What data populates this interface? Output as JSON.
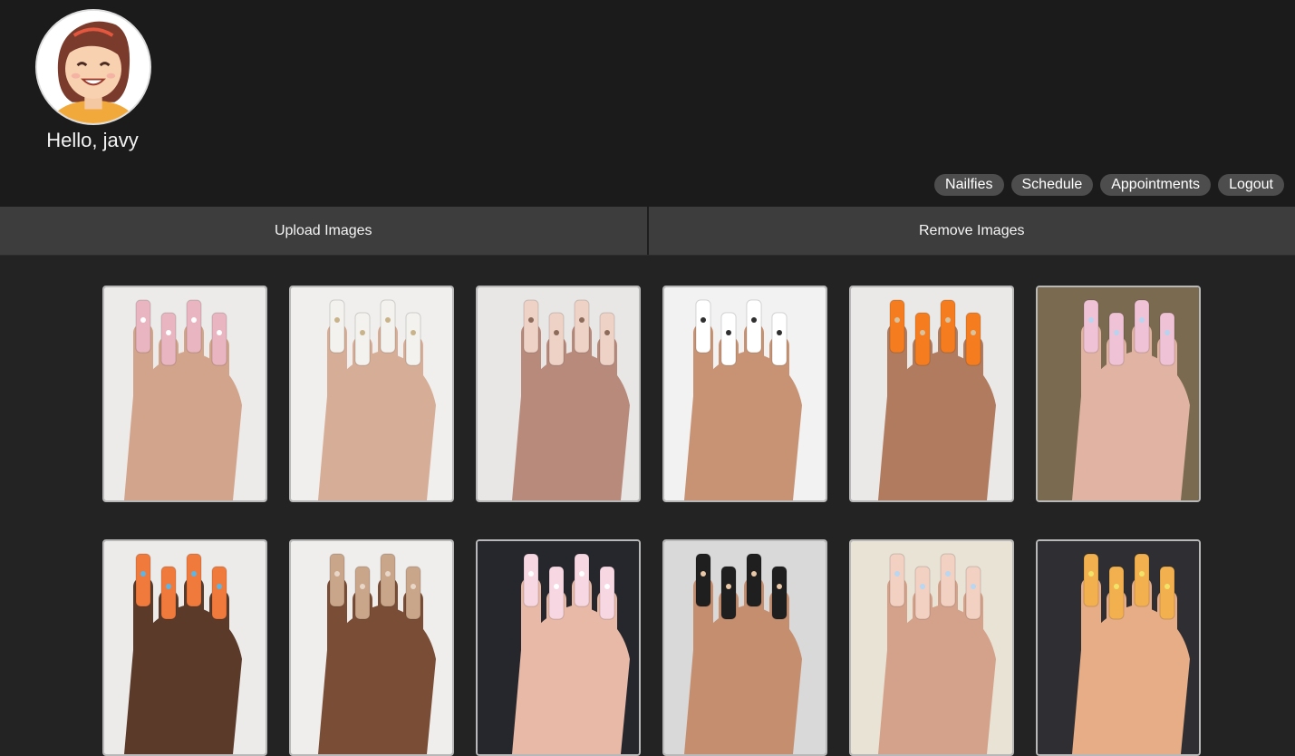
{
  "profile": {
    "greeting": "Hello, javy"
  },
  "nav": [
    {
      "label": "Nailfies"
    },
    {
      "label": "Schedule"
    },
    {
      "label": "Appointments"
    },
    {
      "label": "Logout"
    }
  ],
  "tabs": [
    {
      "label": "Upload Images"
    },
    {
      "label": "Remove Images"
    }
  ],
  "gallery": {
    "images": [
      {
        "icon": "nail-photo-icon",
        "bg": "#ecebea",
        "skin": "#d2a48b",
        "nail": "#e8b5c1",
        "accent": "#ffffff"
      },
      {
        "icon": "nail-photo-icon",
        "bg": "#f1efee",
        "skin": "#d6ad96",
        "nail": "#f3f2ee",
        "accent": "#c9b38a"
      },
      {
        "icon": "nail-photo-icon",
        "bg": "#e9e7e5",
        "skin": "#b88a7b",
        "nail": "#efd2c6",
        "accent": "#8c6b5a"
      },
      {
        "icon": "nail-photo-icon",
        "bg": "#f2f2f2",
        "skin": "#c79374",
        "nail": "#ffffff",
        "accent": "#2f2f2f"
      },
      {
        "icon": "nail-photo-icon",
        "bg": "#ebe9e7",
        "skin": "#b07b5e",
        "nail": "#f57d1f",
        "accent": "#d8c3a0"
      },
      {
        "icon": "nail-photo-icon",
        "bg": "#7a6a4f",
        "skin": "#e0b3a2",
        "nail": "#f0c2d6",
        "accent": "#b9d4ef"
      },
      {
        "icon": "nail-photo-icon",
        "bg": "#ecebea",
        "skin": "#5b3a2a",
        "nail": "#f07a3c",
        "accent": "#5ab6e6"
      },
      {
        "icon": "nail-photo-icon",
        "bg": "#f0eeec",
        "skin": "#7a4e36",
        "nail": "#c9a58a",
        "accent": "#e8d7c8"
      },
      {
        "icon": "nail-photo-icon",
        "bg": "#26272d",
        "skin": "#e7b9a6",
        "nail": "#f7d7e2",
        "accent": "#ffffff"
      },
      {
        "icon": "nail-photo-icon",
        "bg": "#d9d9d9",
        "skin": "#c58e6f",
        "nail": "#1f1f1f",
        "accent": "#e9c7a7"
      },
      {
        "icon": "nail-photo-icon",
        "bg": "#e9e3d6",
        "skin": "#d4a28a",
        "nail": "#f2d1c2",
        "accent": "#b7d7f2"
      },
      {
        "icon": "nail-photo-icon",
        "bg": "#2f2f33",
        "skin": "#e7ad86",
        "nail": "#f2b04f",
        "accent": "#f1e36a"
      }
    ]
  }
}
